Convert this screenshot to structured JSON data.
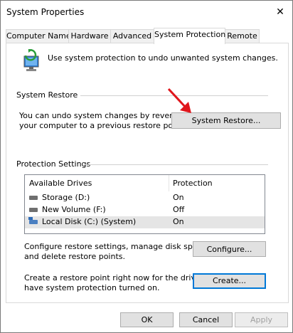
{
  "window": {
    "title": "System Properties"
  },
  "tabs": [
    "Computer Name",
    "Hardware",
    "Advanced",
    "System Protection",
    "Remote"
  ],
  "active_tab": "System Protection",
  "intro": {
    "text": "Use system protection to undo unwanted system changes."
  },
  "system_restore": {
    "group_label": "System Restore",
    "description_line1": "You can undo system changes by reverting",
    "description_line2": "your computer to a previous restore point.",
    "button_label": "System Restore..."
  },
  "protection": {
    "group_label": "Protection Settings",
    "columns": [
      "Available Drives",
      "Protection"
    ],
    "rows": [
      {
        "drive": "Storage (D:)",
        "protection": "On",
        "icon": "drive-icon"
      },
      {
        "drive": "New Volume (F:)",
        "protection": "Off",
        "icon": "drive-icon"
      },
      {
        "drive": "Local Disk (C:) (System)",
        "protection": "On",
        "icon": "system-drive-icon"
      }
    ],
    "configure_line1": "Configure restore settings, manage disk space,",
    "configure_line2": "and delete restore points.",
    "configure_label": "Configure...",
    "create_line1": "Create a restore point right now for the drives that",
    "create_line2": "have system protection turned on.",
    "create_label": "Create..."
  },
  "footer": {
    "ok": "OK",
    "cancel": "Cancel",
    "apply": "Apply"
  },
  "colors": {
    "accent": "#0078d7",
    "annotation_arrow": "#e0161c"
  }
}
